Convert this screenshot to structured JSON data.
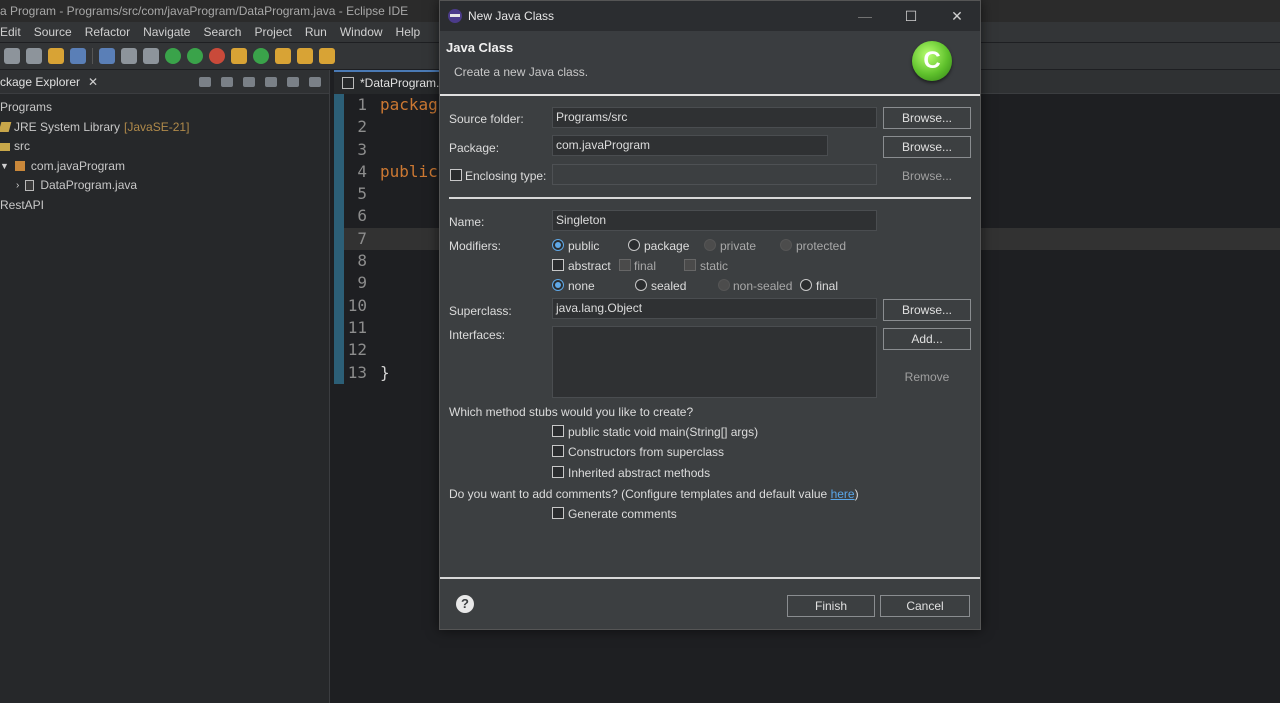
{
  "app": {
    "window_title": "a Program - Programs/src/com/javaProgram/DataProgram.java - Eclipse IDE",
    "menu": [
      "Edit",
      "Source",
      "Refactor",
      "Navigate",
      "Search",
      "Project",
      "Run",
      "Window",
      "Help"
    ]
  },
  "explorer": {
    "tab_label": "ckage Explorer",
    "close_glyph": "✕",
    "tree": {
      "project": "Programs",
      "jre_label": "JRE System Library",
      "jre_version": "[JavaSE-21]",
      "src": "src",
      "package": "com.javaProgram",
      "file": "DataProgram.java",
      "other_project": "RestAPI"
    }
  },
  "editor": {
    "tab_label": "*DataProgram.ja",
    "lines": [
      {
        "num": "1",
        "text": "packag"
      },
      {
        "num": "2",
        "text": ""
      },
      {
        "num": "3",
        "text": ""
      },
      {
        "num": "4",
        "text": "public"
      },
      {
        "num": "5",
        "text": ""
      },
      {
        "num": "6",
        "text": ""
      },
      {
        "num": "7",
        "text": ""
      },
      {
        "num": "8",
        "text": ""
      },
      {
        "num": "9",
        "text": ""
      },
      {
        "num": "10",
        "text": ""
      },
      {
        "num": "11",
        "text": ""
      },
      {
        "num": "12",
        "text": ""
      },
      {
        "num": "13",
        "text": "}"
      }
    ]
  },
  "dialog": {
    "title": "New Java Class",
    "header_title": "Java Class",
    "header_subtitle": "Create a new Java class.",
    "logo_letter": "C",
    "source_folder_label": "Source folder:",
    "source_folder_value": "Programs/src",
    "package_label": "Package:",
    "package_value": "com.javaProgram",
    "enclosing_type_label": "Enclosing type:",
    "enclosing_type_value": "",
    "browse_label": "Browse...",
    "name_label": "Name:",
    "name_value": "Singleton",
    "modifiers_label": "Modifiers:",
    "modifiers_row1": {
      "public": "public",
      "package": "package",
      "private": "private",
      "protected": "protected"
    },
    "modifiers_row2": {
      "abstract": "abstract",
      "final": "final",
      "static": "static"
    },
    "modifiers_row3": {
      "none": "none",
      "sealed": "sealed",
      "non_sealed": "non-sealed",
      "final": "final"
    },
    "superclass_label": "Superclass:",
    "superclass_value": "java.lang.Object",
    "interfaces_label": "Interfaces:",
    "add_label": "Add...",
    "remove_label": "Remove",
    "stubs_question": "Which method stubs would you like to create?",
    "stub_main": "public static void main(String[] args)",
    "stub_constructors": "Constructors from superclass",
    "stub_inherited": "Inherited abstract methods",
    "comments_question_prefix": "Do you want to add comments? (Configure templates and default value ",
    "comments_link": "here",
    "comments_question_suffix": ")",
    "generate_comments": "Generate comments",
    "help_glyph": "?",
    "finish_label": "Finish",
    "cancel_label": "Cancel",
    "win_minimize": "—",
    "win_maximize": "☐",
    "win_close": "✕"
  },
  "colors": {
    "selection_accent": "#5fa8e6",
    "keyword": "#cc7832",
    "logo_green": "#5fc12c"
  }
}
